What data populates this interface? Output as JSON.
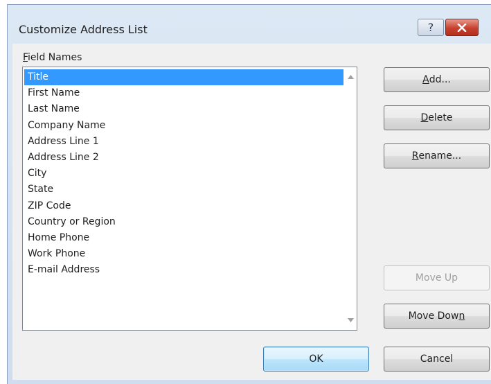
{
  "window": {
    "title": "Customize Address List",
    "help_glyph": "?",
    "close_glyph": "×"
  },
  "field_names": {
    "label_access": "F",
    "label_rest": "ield Names",
    "items": [
      "Title",
      "First Name",
      "Last Name",
      "Company Name",
      "Address Line 1",
      "Address Line 2",
      "City",
      "State",
      "ZIP Code",
      "Country or Region",
      "Home Phone",
      "Work Phone",
      "E-mail Address"
    ],
    "selected": "Title"
  },
  "buttons": {
    "add": {
      "access": "A",
      "rest": "dd..."
    },
    "delete": {
      "access": "D",
      "rest": "elete"
    },
    "rename": {
      "access": "R",
      "rest": "ename..."
    },
    "move_up": "Move Up",
    "move_down": {
      "pre": "Move Dow",
      "access": "n"
    },
    "ok": "OK",
    "cancel": "Cancel"
  },
  "colors": {
    "selection": "#3399ff",
    "close_button": "#c6412d",
    "titlebar": "#dde8f5"
  }
}
